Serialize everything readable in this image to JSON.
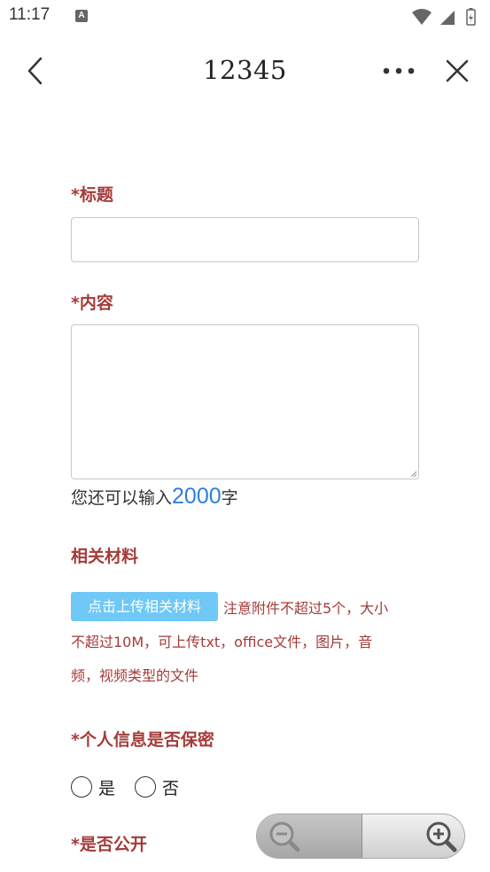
{
  "status_bar": {
    "time": "11:17",
    "notification_letter": "A"
  },
  "header": {
    "title": "12345",
    "back_icon": "chevron-left-icon",
    "more_icon": "more-horizontal-icon",
    "close_icon": "close-icon"
  },
  "form": {
    "title_label": "*标题",
    "title_value": "",
    "content_label": "*内容",
    "content_value": "",
    "count_prefix": "您还可以输入",
    "count_number": "2000",
    "count_suffix": "字",
    "materials_label": "相关材料",
    "upload_button": "点击上传相关材料",
    "upload_note_line1": "注意附件不超过5个，大小",
    "upload_note_line2": "不超过10M，可上传txt，office文件，图片，音",
    "upload_note_line3": "频，视频类型的文件",
    "privacy_label": "*个人信息是否保密",
    "privacy_options": [
      "是",
      "否"
    ],
    "public_label": "*是否公开"
  },
  "zoom": {
    "zoom_out_icon": "zoom-out-icon",
    "zoom_in_icon": "zoom-in-icon"
  },
  "colors": {
    "label": "#a43b39",
    "accent_blue": "#2f7fd8",
    "upload_button": "#6fc8f5"
  }
}
